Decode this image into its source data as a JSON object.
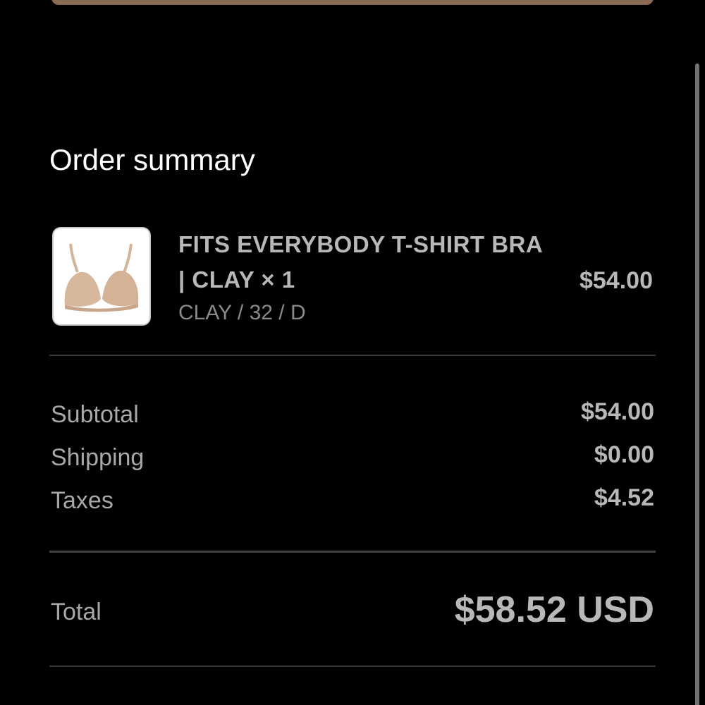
{
  "colors": {
    "background": "#000000",
    "accent_button": "#8a6a53",
    "text_primary": "#ffffff",
    "text_secondary": "#b8b8b8",
    "text_muted": "#8a8a8a",
    "divider": "#3a3a3a",
    "product_beige": "#d8b89c"
  },
  "order_summary": {
    "title": "Order summary",
    "item": {
      "name": "FITS EVERYBODY T-SHIRT BRA | CLAY × 1",
      "variant": "CLAY / 32 / D",
      "price": "$54.00",
      "image_icon": "bra-product-image"
    },
    "rows": [
      {
        "label": "Subtotal",
        "value": "$54.00"
      },
      {
        "label": "Shipping",
        "value": "$0.00"
      },
      {
        "label": "Taxes",
        "value": "$4.52"
      }
    ],
    "total": {
      "label": "Total",
      "value": "$58.52 USD"
    }
  }
}
